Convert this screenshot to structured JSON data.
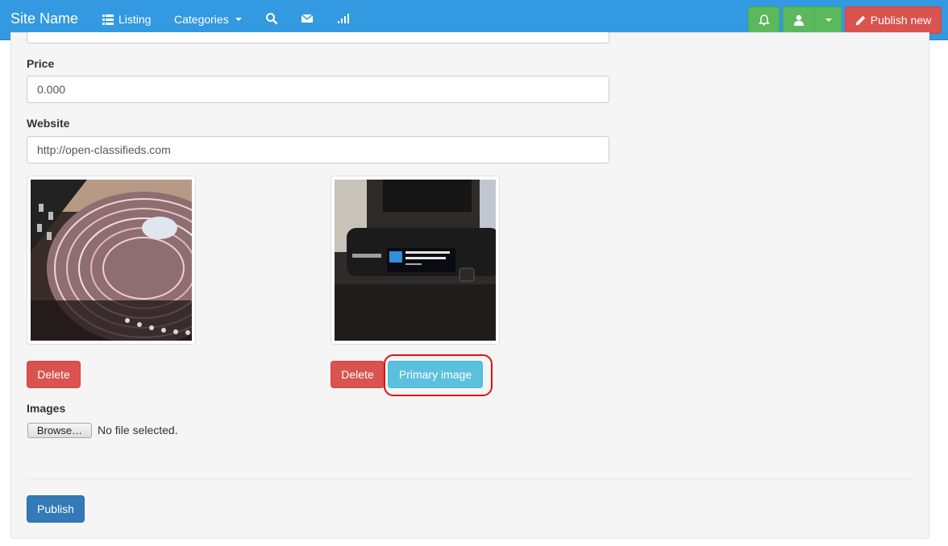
{
  "navbar": {
    "brand": "Site Name",
    "listing_label": "Listing",
    "categories_label": "Categories",
    "publish_new_label": "Publish new"
  },
  "form": {
    "price_label": "Price",
    "price_value": "0.000",
    "website_label": "Website",
    "website_value": "http://open-classifieds.com",
    "images_label": "Images",
    "browse_label": "Browse…",
    "no_file_text": "No file selected."
  },
  "images": [
    {
      "delete_label": "Delete",
      "description": "turntable-photo"
    },
    {
      "delete_label": "Delete",
      "primary_label": "Primary image",
      "description": "sony-walkman-photo"
    }
  ],
  "actions": {
    "publish_label": "Publish"
  },
  "colors": {
    "navbar": "#3399e0",
    "success": "#5cb85c",
    "danger": "#d9534f",
    "info": "#5bc0de",
    "primary": "#337ab7",
    "highlight": "#e01010"
  },
  "icons": [
    "list-icon",
    "search-icon",
    "envelope-icon",
    "signal-icon",
    "bell-icon",
    "user-icon",
    "pencil-icon"
  ]
}
